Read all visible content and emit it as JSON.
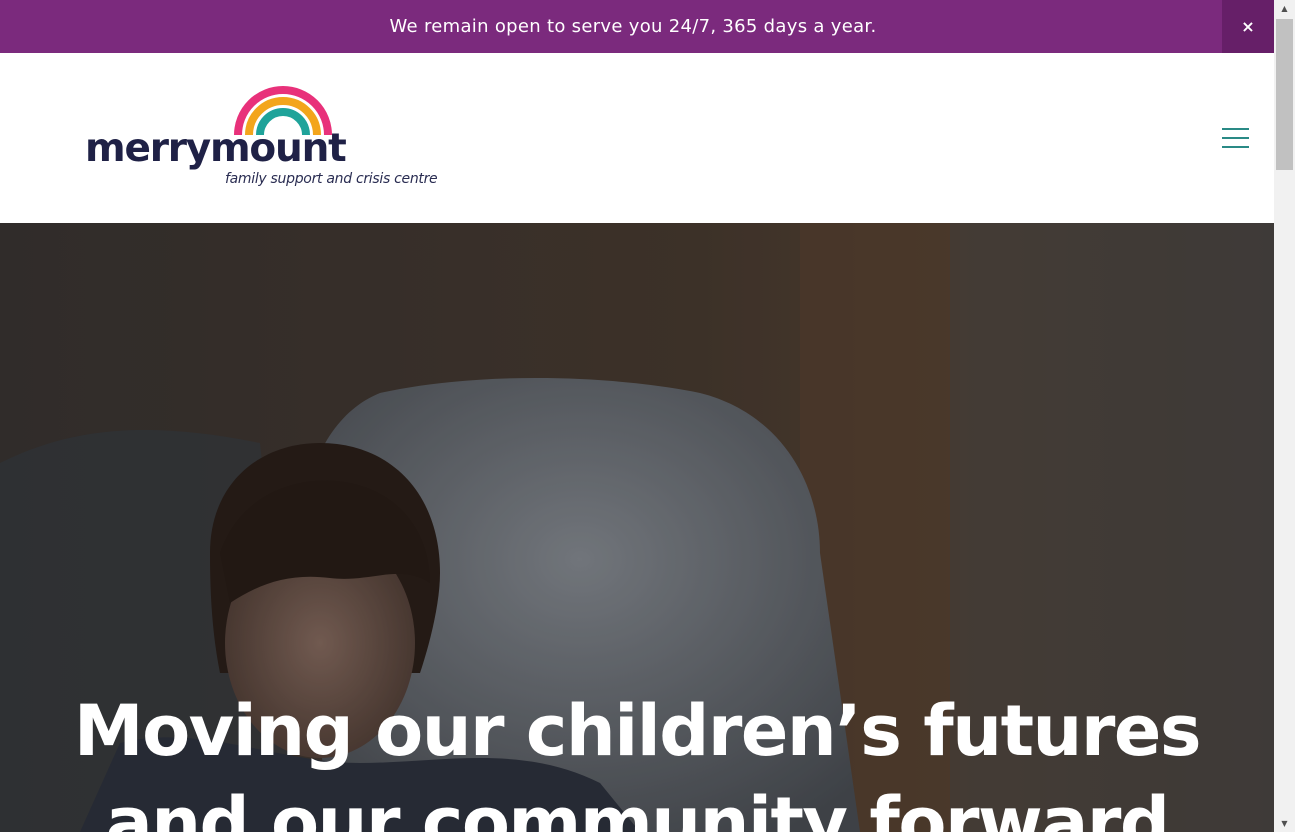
{
  "announcement": {
    "text": "We remain open to serve you 24/7, 365 days a year.",
    "close_label": "×",
    "background": "#7b2a7d"
  },
  "header": {
    "logo": {
      "wordmark": "merrymount",
      "tagline": "family support and crisis centre"
    },
    "menu_icon": "hamburger-icon"
  },
  "hero": {
    "title": "Moving our children’s futures and our community forward"
  },
  "colors": {
    "brand_purple": "#7b2a7d",
    "brand_navy": "#1f2146",
    "accent_teal": "#2a8a86"
  }
}
